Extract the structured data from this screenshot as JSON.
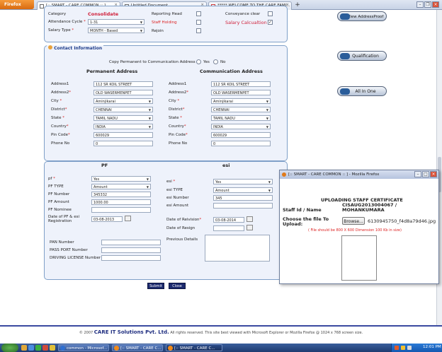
{
  "browser": {
    "menu_label": "Firefox",
    "tabs": [
      {
        "label": "[:: SMART - CARE COMMON :: ]"
      },
      {
        "label": "Untitled Document"
      },
      {
        "label": "***** WELCOME TO THE CARE FAMI..."
      }
    ],
    "new_tab": "+"
  },
  "top_fields": {
    "category_label": "Category",
    "category_value": "Consolidate",
    "attendance_label": "Attendance Cycle",
    "attendance_value": "1-31",
    "salary_type_label": "Salary Type",
    "salary_type_value": "MONTH - Based",
    "reporting_head_label": "Reporting Head",
    "staff_holding_label": "Staff Holding",
    "rejoin_label": "Rejoin",
    "conveyance_label": "Conveyance clear",
    "salary_calc_label": "Salary Calcualtion"
  },
  "side_buttons": {
    "view_address_proof": "View AddressProof",
    "qualification": "Qualification",
    "all_in_one": "All In One"
  },
  "contact": {
    "legend": "Contact Information",
    "permanent_question": "Copy Permanent to Communication Address",
    "yes_label": "Yes",
    "no_label": "No",
    "permanent_heading": "Permanent Address",
    "communication_heading": "Communication Address",
    "labels": {
      "address1": "Address1",
      "address2": "Address2",
      "city": "City",
      "district": "District",
      "state": "State",
      "country": "Country",
      "pincode": "Pin Code",
      "phone": "Phone No"
    },
    "permanent": {
      "address1": "112 SR KOIL STREET",
      "address2": "OLD WASERMENPET",
      "city": "Aminjikarai",
      "district": "CHENNAI",
      "state": "TAMIL NADU",
      "country": "INDIA",
      "pincode": "600029",
      "phone": "0"
    },
    "communication": {
      "address1": "112 SR KOIL STREET",
      "address2": "OLD WASERMENPET",
      "city": "Aminjikarai",
      "district": "CHENNAI",
      "state": "TAMIL NADU",
      "country": "INDIA",
      "pincode": "600029",
      "phone": "0"
    }
  },
  "pf": {
    "heading": "PF",
    "pf_label": "pf",
    "pf_value": "Yes",
    "pf_type_label": "PF TYPE",
    "pf_type_value": "Amount",
    "pf_number_label": "PF Number",
    "pf_number_value": "345332",
    "pf_amount_label": "PF Amount",
    "pf_amount_value": "1000.00",
    "pf_nominee_label": "PF Nominee",
    "pf_nominee_value": "",
    "date_label": "Date of PF & esi Registration",
    "date_value": "03-08-2013"
  },
  "esi": {
    "heading": "esi",
    "esi_label": "esi",
    "esi_value": "Yes",
    "esi_type_label": "esi TYPE",
    "esi_type_value": "Amount",
    "esi_number_label": "esi Number",
    "esi_number_value": "345",
    "esi_amount_label": "esi Amount",
    "esi_amount_value": "",
    "revision_label": "Date of Reivision",
    "revision_value": "03-08-2014",
    "resign_label": "Date of Resign",
    "resign_value": ""
  },
  "other_ids": {
    "pan_label": "PAN Number",
    "passport_label": "PASS PORT Number",
    "driving_label": "DRIVING LICENSE Number",
    "previous_details_label": "Previous Details"
  },
  "form_buttons": {
    "submit": "Submit",
    "close": "Close"
  },
  "popup": {
    "title": "[:: SMART - CARE COMMON :: ] - Mozilla Firefox",
    "heading": "UPLOADING STAFF CERTIFICATE",
    "staff_label": "Staff Id / Name",
    "staff_value": "CISAUG2013004067 / MOHANKUMARA",
    "choose_label": "Choose the file To Upload:",
    "browse_label": "Browse...",
    "file_name": "6130945750_f4d8a79d46.jpg",
    "note": "( File should be 800 X 600 Dimension 100 Kb in size)"
  },
  "footer": {
    "copyright": "© 2007",
    "company": "CARE IT Solutions Pvt. Ltd.",
    "rights": "All rights reserved.  This site best viewed with Microsoft Explorer or Mozilla Firefox @ 1024 x 768 screen size."
  },
  "taskbar": {
    "items": [
      "common - Microsof...",
      "[:: SMART - CARE C...",
      "[:: SMART - CARE C..."
    ],
    "clock": "12:01 PM"
  }
}
